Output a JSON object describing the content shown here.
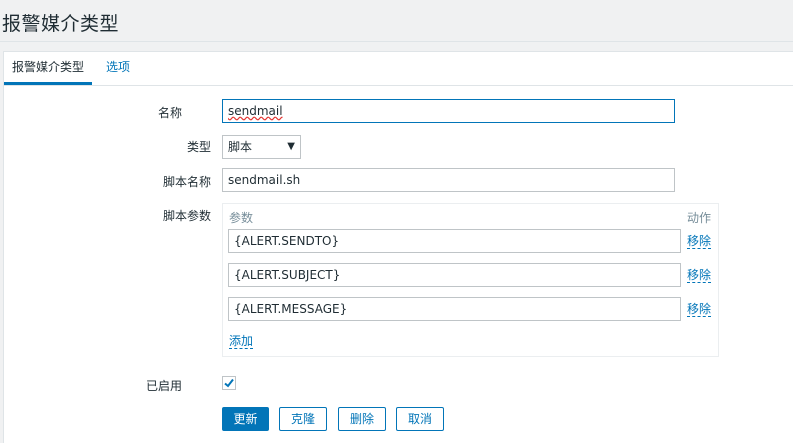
{
  "page": {
    "title": "报警媒介类型"
  },
  "tabs": [
    {
      "label": "报警媒介类型",
      "active": true
    },
    {
      "label": "选项",
      "active": false
    }
  ],
  "form": {
    "name_label": "名称",
    "name_value": "sendmail",
    "type_label": "类型",
    "type_value": "脚本",
    "script_name_label": "脚本名称",
    "script_name_value": "sendmail.sh",
    "script_params_label": "脚本参数",
    "params_header": "参数",
    "action_header": "动作",
    "params": [
      {
        "value": "{ALERT.SENDTO}",
        "remove_label": "移除"
      },
      {
        "value": "{ALERT.SUBJECT}",
        "remove_label": "移除"
      },
      {
        "value": "{ALERT.MESSAGE}",
        "remove_label": "移除"
      }
    ],
    "add_label": "添加",
    "enabled_label": "已启用",
    "enabled": true
  },
  "buttons": {
    "update": "更新",
    "clone": "克隆",
    "delete": "删除",
    "cancel": "取消"
  },
  "colors": {
    "accent": "#0275b8",
    "text": "#1f2c33",
    "muted": "#768d99"
  }
}
